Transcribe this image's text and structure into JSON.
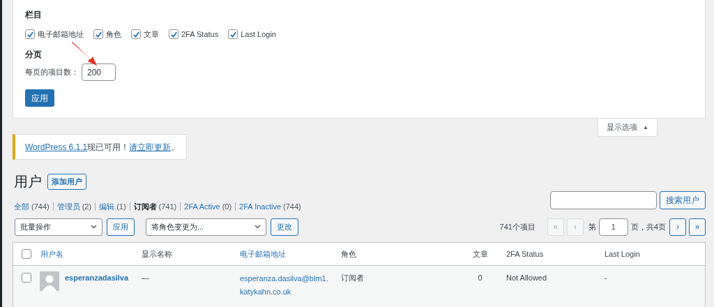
{
  "screen_options": {
    "columns_heading": "栏目",
    "columns": [
      {
        "label": "电子邮箱地址",
        "checked": true
      },
      {
        "label": "角色",
        "checked": true
      },
      {
        "label": "文章",
        "checked": true
      },
      {
        "label": "2FA Status",
        "checked": true
      },
      {
        "label": "Last Login",
        "checked": true
      }
    ],
    "pagination_heading": "分页",
    "per_page_label": "每页的项目数：",
    "per_page_value": "200",
    "apply_button": "应用",
    "tab": "显示选项",
    "tab_icon": "▲"
  },
  "notice": {
    "link": "WordPress 6.1.1",
    "text": "现已可用！",
    "action_link": "请立即更新",
    "end": "。"
  },
  "page_title": "用户",
  "add_button": "添加用户",
  "filters": [
    {
      "label": "全部",
      "count": "(744)",
      "selected": false
    },
    {
      "label": "管理员",
      "count": "(2)",
      "selected": false
    },
    {
      "label": "编辑",
      "count": "(1)",
      "selected": false
    },
    {
      "label": "订阅者",
      "count": "(741)",
      "selected": true
    },
    {
      "label": "2FA Active",
      "count": "(0)",
      "selected": false
    },
    {
      "label": "2FA Inactive",
      "count": "(744)",
      "selected": false
    }
  ],
  "search_button": "搜索用户",
  "bulk_actions": {
    "select": "批量操作",
    "apply": "应用"
  },
  "change_role": {
    "select": "将角色变更为...",
    "button": "更改"
  },
  "pagination": {
    "count": "741个项目",
    "first": "«",
    "prev": "‹",
    "page_label": "第",
    "page": "1",
    "of_pages": "页，共4页",
    "next": "›",
    "last": "»"
  },
  "table": {
    "select_all_checked": false,
    "columns": [
      {
        "label": "用户名",
        "sortable": true
      },
      {
        "label": "显示名称",
        "sortable": false
      },
      {
        "label": "电子邮箱地址",
        "sortable": true
      },
      {
        "label": "角色",
        "sortable": false
      },
      {
        "label": "文章",
        "sortable": false
      },
      {
        "label": "2FA Status",
        "sortable": false
      },
      {
        "label": "Last Login",
        "sortable": false
      }
    ],
    "rows": [
      {
        "username": "esperanzadasilva",
        "display_name": "—",
        "email": "esperanza.dasilva@blm1.katykahn.co.uk",
        "role": "订阅者",
        "posts": "0",
        "twofa": "Not Allowed",
        "last_login": "-",
        "checked": false
      }
    ]
  }
}
